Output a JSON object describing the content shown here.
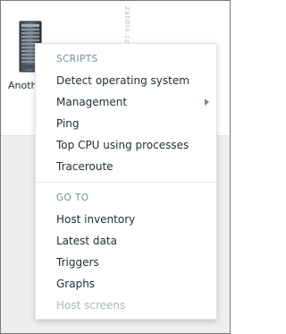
{
  "map": {
    "host_label": "Anoth",
    "watermark": "zabbix.com"
  },
  "menu": {
    "scripts_header": "SCRIPTS",
    "scripts": [
      {
        "label": "Detect operating system"
      },
      {
        "label": "Management"
      },
      {
        "label": "Ping"
      },
      {
        "label": "Top CPU using processes"
      },
      {
        "label": "Traceroute"
      }
    ],
    "goto_header": "GO TO",
    "goto": [
      {
        "label": "Host inventory"
      },
      {
        "label": "Latest data"
      },
      {
        "label": "Triggers"
      },
      {
        "label": "Graphs"
      },
      {
        "label": "Host screens",
        "disabled": true
      }
    ]
  }
}
